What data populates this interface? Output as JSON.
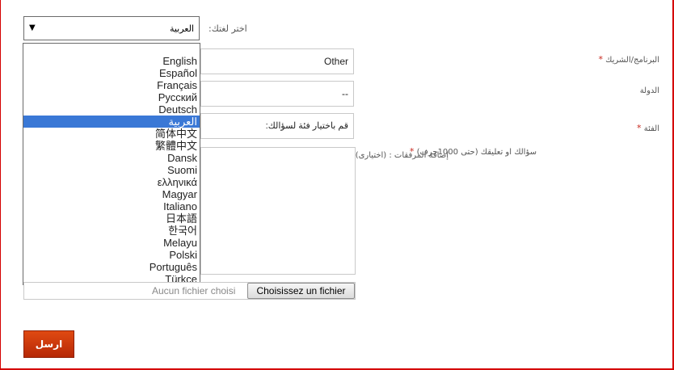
{
  "language_selector": {
    "label": "اختر لغتك:",
    "selected_value": "العربية",
    "options": [
      "English",
      "Español",
      "Français",
      "Русский",
      "Deutsch",
      "العربية",
      "简体中文",
      "繁體中文",
      "Dansk",
      "Suomi",
      "ελληνικά",
      "Magyar",
      "Italiano",
      "日本語",
      "한국어",
      "Melayu",
      "Polski",
      "Português",
      "Türkçe"
    ],
    "selected_index": 5
  },
  "form": {
    "program_label": "البرنامج/الشريك",
    "program_value": "Other",
    "country_label": "الدولة",
    "country_value": "--",
    "category_label": "الفئة",
    "category_value": "قم باختيار فئة لسؤالك:",
    "question_label": "سؤالك او تعليقك (حتى 1000حرف)",
    "attachments_label": "إضافة المرفقات : (اختيارى)",
    "required_marker": "*",
    "file_status": "Aucun fichier choisi",
    "file_button": "Choisissez un fichier",
    "submit_label": "ارسل"
  },
  "colors": {
    "frame": "#d40000",
    "selected_option": "#3a78d6",
    "submit": "#c8380c",
    "required": "#c8281e"
  }
}
